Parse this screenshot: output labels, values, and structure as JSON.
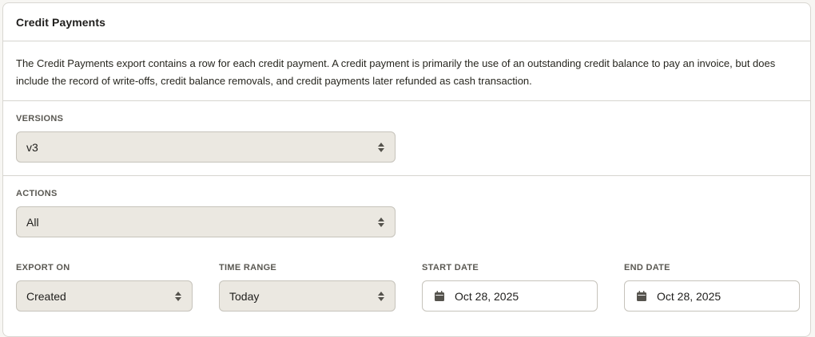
{
  "card": {
    "title": "Credit Payments",
    "description": "The Credit Payments export contains a row for each credit payment. A credit payment is primarily the use of an outstanding credit balance to pay an invoice, but does include the record of write-offs, credit balance removals, and credit payments later refunded as cash transaction."
  },
  "versions": {
    "label": "VERSIONS",
    "value": "v3"
  },
  "actions": {
    "label": "ACTIONS",
    "value": "All"
  },
  "export_on": {
    "label": "EXPORT ON",
    "value": "Created"
  },
  "time_range": {
    "label": "TIME RANGE",
    "value": "Today"
  },
  "start_date": {
    "label": "START DATE",
    "value": "Oct 28, 2025",
    "icon": "calendar-icon"
  },
  "end_date": {
    "label": "END DATE",
    "value": "Oct 28, 2025",
    "icon": "calendar-icon"
  },
  "colors": {
    "select_bg": "#ebe8e1",
    "border": "#c6c3bb",
    "divider": "#d6d4cf"
  }
}
